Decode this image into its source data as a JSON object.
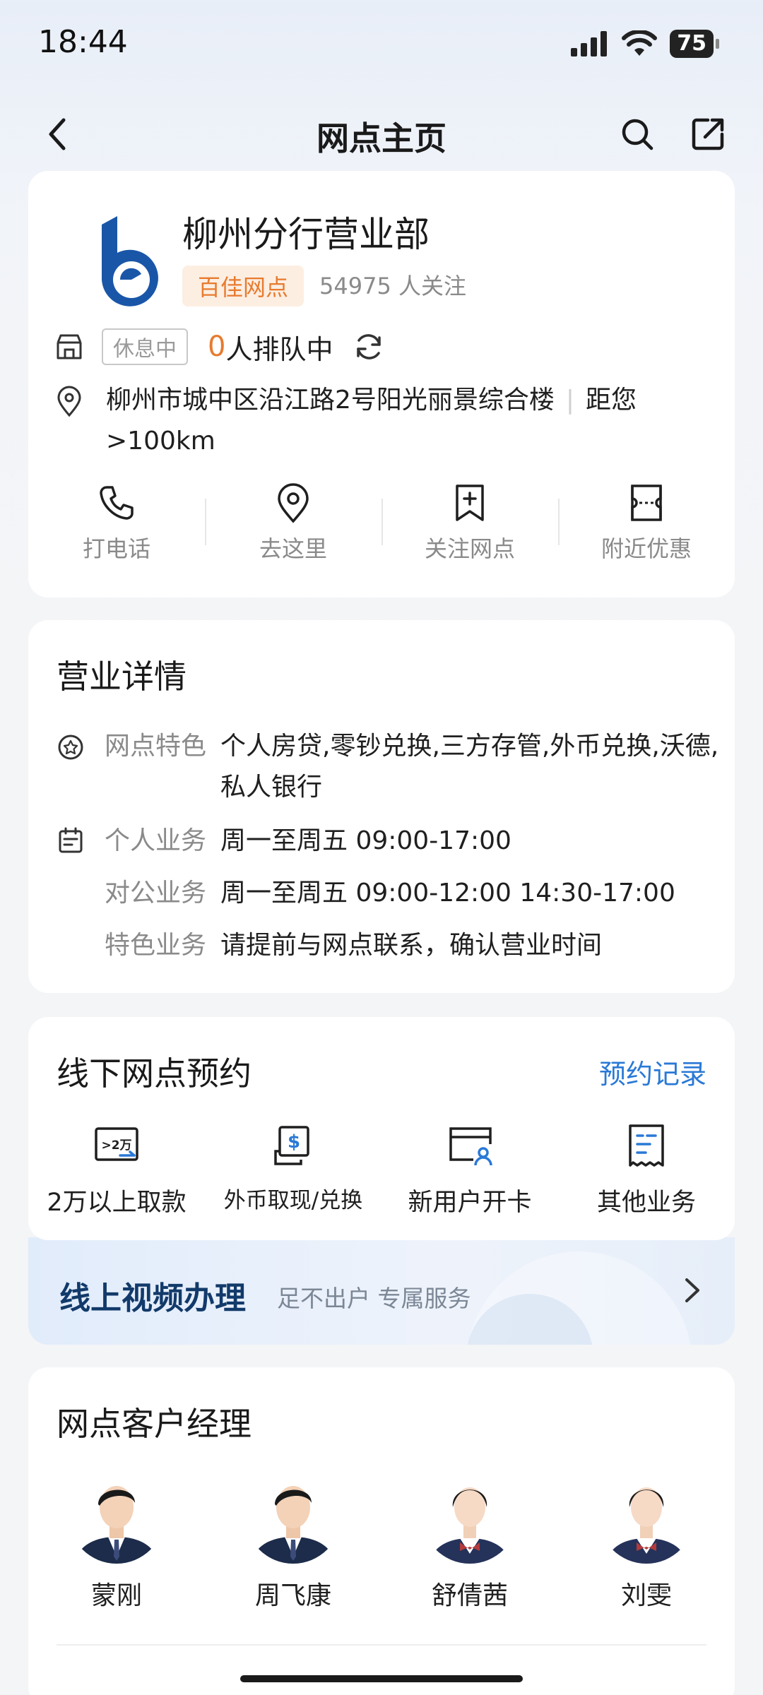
{
  "status_bar": {
    "time": "18:44",
    "battery": "75"
  },
  "nav": {
    "title": "网点主页"
  },
  "branch": {
    "name": "柳州分行营业部",
    "tag": "百佳网点",
    "followers_count": "54975",
    "followers_suffix": " 人关注",
    "status": "休息中",
    "queue_count": "0",
    "queue_text": "人排队中",
    "address": "柳州市城中区沿江路2号阳光丽景综合楼",
    "distance": "距您>100km",
    "actions": [
      {
        "label": "打电话",
        "icon": "phone-icon"
      },
      {
        "label": "去这里",
        "icon": "location-icon"
      },
      {
        "label": "关注网点",
        "icon": "bookmark-add-icon"
      },
      {
        "label": "附近优惠",
        "icon": "coupon-icon"
      }
    ]
  },
  "hours": {
    "title": "营业详情",
    "features_label": "网点特色",
    "features_value": "个人房贷,零钞兑换,三方存管,外币兑换,沃德,私人银行",
    "personal_label": "个人业务",
    "personal_value": "周一至周五 09:00-17:00",
    "corporate_label": "对公业务",
    "corporate_value": "周一至周五 09:00-12:00 14:30-17:00",
    "special_label": "特色业务",
    "special_value": "请提前与网点联系，确认营业时间"
  },
  "booking": {
    "title": "线下网点预约",
    "record_link": "预约记录",
    "items": [
      {
        "label": "2万以上取款",
        "icon": "withdraw-20k-icon"
      },
      {
        "label": "外币取现/兑换",
        "icon": "currency-exchange-icon"
      },
      {
        "label": "新用户开卡",
        "icon": "new-card-icon"
      },
      {
        "label": "其他业务",
        "icon": "document-icon"
      }
    ]
  },
  "video": {
    "title": "线上视频办理",
    "subtitle": "足不出户 专属服务"
  },
  "managers": {
    "title": "网点客户经理",
    "people": [
      {
        "name": "蒙刚"
      },
      {
        "name": "周飞康"
      },
      {
        "name": "舒倩茜"
      },
      {
        "name": "刘雯"
      }
    ]
  },
  "colors": {
    "accent_orange": "#e77b2f",
    "link_blue": "#2a79d6",
    "logo_blue": "#1a56a8"
  }
}
